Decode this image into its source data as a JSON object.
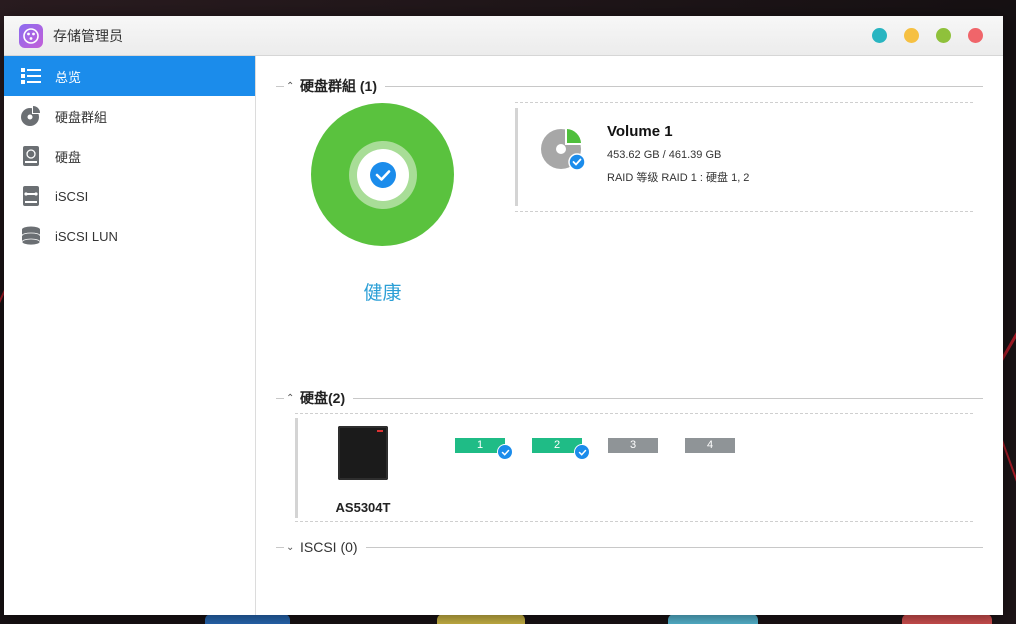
{
  "window": {
    "title": "存储管理员",
    "controls": [
      {
        "name": "help",
        "color": "#29b5c1"
      },
      {
        "name": "minimize",
        "color": "#f6c042"
      },
      {
        "name": "maximize",
        "color": "#8fc13b"
      },
      {
        "name": "close",
        "color": "#f0656a"
      }
    ]
  },
  "sidebar": {
    "items": [
      {
        "label": "总览",
        "icon": "overview-list-icon",
        "active": true
      },
      {
        "label": "硬盘群組",
        "icon": "disk-group-icon",
        "active": false
      },
      {
        "label": "硬盘",
        "icon": "hard-disk-icon",
        "active": false
      },
      {
        "label": "iSCSI",
        "icon": "iscsi-icon",
        "active": false
      },
      {
        "label": "iSCSI LUN",
        "icon": "iscsi-lun-icon",
        "active": false
      }
    ]
  },
  "sections": {
    "disk_group": {
      "title": "硬盘群組 (1)",
      "status": "健康",
      "volume": {
        "name": "Volume 1",
        "size": "453.62 GB / 461.39 GB",
        "raid": "RAID 等级 RAID 1 : 硬盘 1, 2"
      }
    },
    "disks": {
      "title": "硬盘(2)",
      "device": "AS5304T",
      "slots": [
        {
          "label": "1",
          "status": "ok"
        },
        {
          "label": "2",
          "status": "ok"
        },
        {
          "label": "3",
          "status": "empty"
        },
        {
          "label": "4",
          "status": "empty"
        }
      ]
    },
    "iscsi": {
      "title": "ISCSI (0)"
    }
  },
  "colors": {
    "accent": "#1b8ceb",
    "healthy": "#5ac23e",
    "status_text": "#2b9fd6",
    "slot_ok": "#1fbc86",
    "slot_empty": "#8f9497"
  }
}
